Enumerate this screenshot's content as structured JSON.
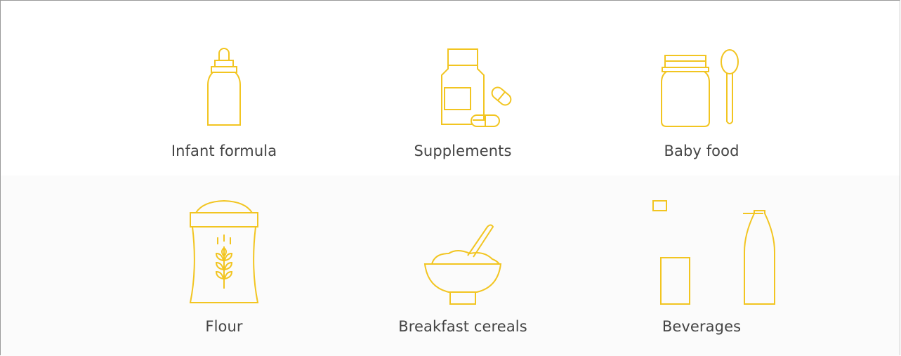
{
  "accent_color": "#f2c521",
  "label_color": "#444444",
  "categories": [
    {
      "label": "Infant formula",
      "icon": "baby-bottle-icon"
    },
    {
      "label": "Supplements",
      "icon": "supplements-icon"
    },
    {
      "label": "Baby food",
      "icon": "baby-food-jar-icon"
    },
    {
      "label": "Flour",
      "icon": "flour-sack-icon"
    },
    {
      "label": "Breakfast cereals",
      "icon": "cereal-bowl-icon"
    },
    {
      "label": "Beverages",
      "icon": "beverages-icon"
    }
  ]
}
